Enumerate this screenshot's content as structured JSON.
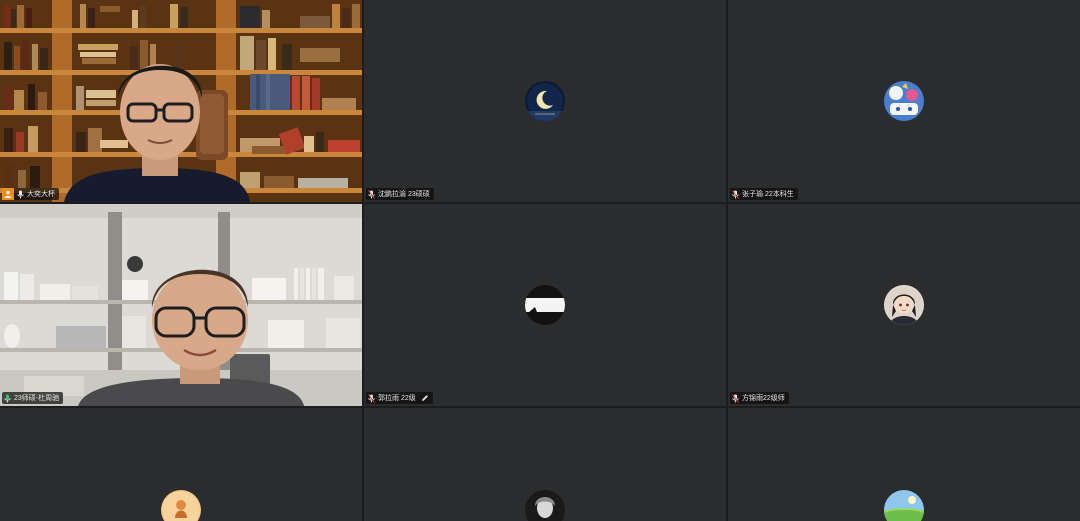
{
  "participants": [
    {
      "id": "p1",
      "name": "大奕大杯",
      "type": "video",
      "host": true
    },
    {
      "id": "p2",
      "name": "沈鹏拉渝 23硕硕",
      "type": "avatar",
      "avatar": "moon-night"
    },
    {
      "id": "p3",
      "name": "张子瑜 22本科生",
      "type": "avatar",
      "avatar": "colorful-cartoon"
    },
    {
      "id": "p4",
      "name": "23师硕-杜周驰",
      "type": "video",
      "speaking": true
    },
    {
      "id": "p5",
      "name": "郭拉雨 22级",
      "type": "avatar",
      "avatar": "white-stripe",
      "editable": true
    },
    {
      "id": "p6",
      "name": "方锦雨22级师",
      "type": "avatar",
      "avatar": "anime-girl"
    },
    {
      "id": "p7",
      "name": "",
      "type": "avatar",
      "avatar": "orange-sketch"
    },
    {
      "id": "p8",
      "name": "",
      "type": "avatar",
      "avatar": "bw-photo"
    },
    {
      "id": "p9",
      "name": "",
      "type": "avatar",
      "avatar": "green-field"
    }
  ],
  "colors": {
    "tile_bg": "#2b2c2e",
    "grid_bg": "#1b1c1e",
    "speaking_border": "#2fa35a",
    "host_badge": "#f08a1c"
  }
}
